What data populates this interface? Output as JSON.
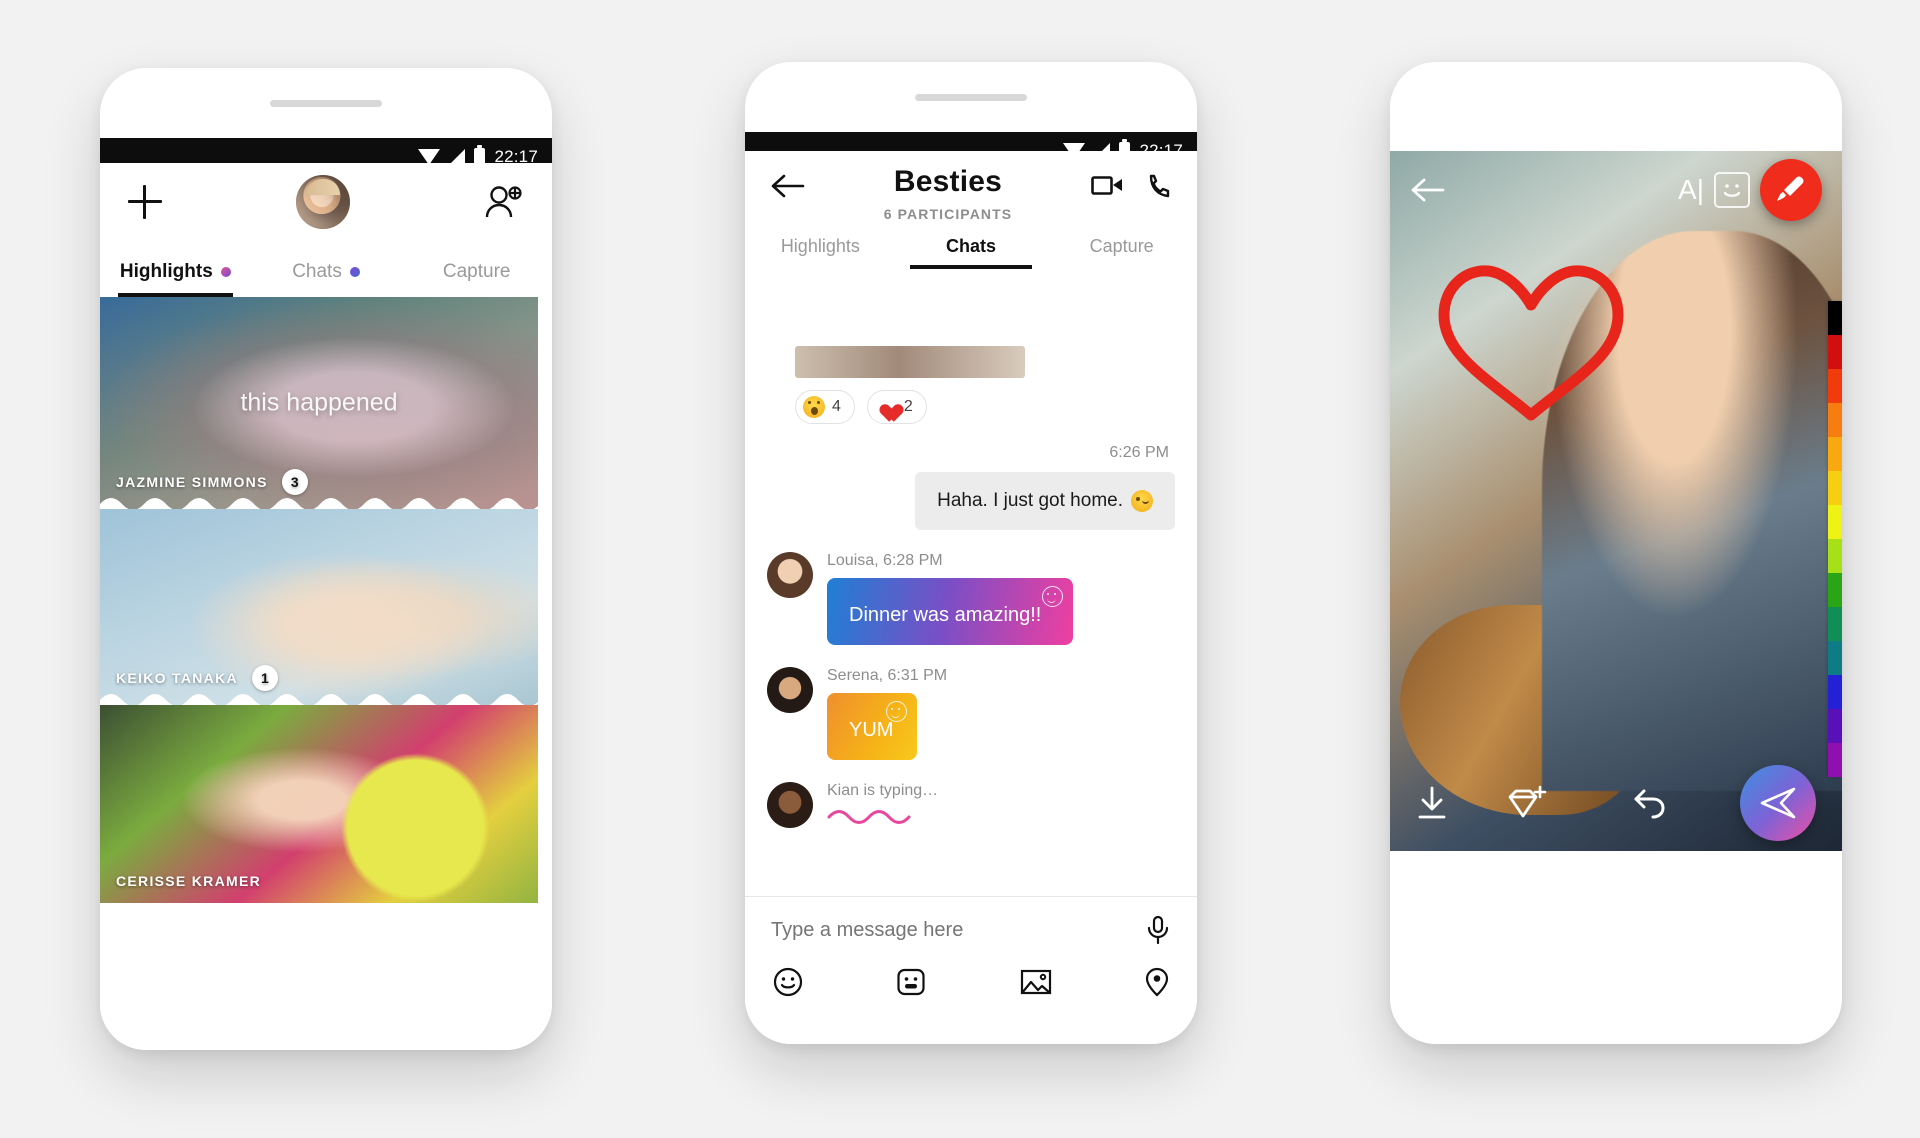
{
  "status_bar": {
    "time": "22:17",
    "wifi_icon": "wifi-icon",
    "signal_icon": "signal-icon",
    "battery_icon": "battery-icon"
  },
  "phone1": {
    "add_icon": "plus-icon",
    "avatar_name": "my-avatar",
    "add_friend_icon": "add-friend-icon",
    "tabs": [
      {
        "label": "Highlights",
        "active": true,
        "dot": true
      },
      {
        "label": "Chats",
        "active": false,
        "dot": true
      },
      {
        "label": "Capture",
        "active": false,
        "dot": false
      }
    ],
    "caption": "this happened",
    "highlights": [
      {
        "name": "JAZMINE SIMMONS",
        "badge": "3"
      },
      {
        "name": "KEIKO TANAKA",
        "badge": "1"
      },
      {
        "name": "CERISSE KRAMER",
        "badge": ""
      }
    ]
  },
  "phone2": {
    "back_icon": "back-arrow-icon",
    "title": "Besties",
    "subtitle": "6 PARTICIPANTS",
    "video_icon": "video-call-icon",
    "call_icon": "phone-call-icon",
    "tabs": [
      {
        "label": "Highlights",
        "active": false
      },
      {
        "label": "Chats",
        "active": true
      },
      {
        "label": "Capture",
        "active": false
      }
    ],
    "reactions": [
      {
        "emoji": "wow-emoji",
        "count": "4"
      },
      {
        "emoji": "heart-emoji",
        "count": "2"
      }
    ],
    "outgoing_time": "6:26 PM",
    "outgoing_text": "Haha. I just got home.",
    "messages": [
      {
        "author": "Louisa",
        "time": "6:28 PM",
        "meta": "Louisa, 6:28 PM",
        "text": "Dinner was amazing!!",
        "style": "gradient-blue-pink"
      },
      {
        "author": "Serena",
        "time": "6:31 PM",
        "meta": "Serena, 6:31 PM",
        "text": "YUM",
        "style": "gradient-orange"
      }
    ],
    "typing": {
      "text": "Kian is typing…",
      "author": "Kian"
    },
    "composer": {
      "placeholder": "Type a message here",
      "value": "",
      "mic_icon": "microphone-icon",
      "actions": [
        "emoji-icon",
        "sticker-icon",
        "gallery-icon",
        "location-icon"
      ]
    }
  },
  "phone3": {
    "back_icon": "back-arrow-icon",
    "text_tool_label": "A",
    "sticker_icon": "sticker-icon",
    "brush_icon": "brush-icon",
    "brush_fab_color": "#f02c1d",
    "drawing": "red-heart-drawing",
    "drawing_color": "#e8251b",
    "palette_colors": [
      "#000000",
      "#d10f0f",
      "#f23b0d",
      "#f77d10",
      "#f9a90f",
      "#f6cf12",
      "#eff215",
      "#a8e018",
      "#2aa515",
      "#0f8f56",
      "#0d7c86",
      "#2320d6",
      "#5a10b8",
      "#8f0fb0"
    ],
    "bottom_actions": [
      "download-icon",
      "add-gem-icon",
      "undo-icon"
    ],
    "send_icon": "send-icon"
  }
}
